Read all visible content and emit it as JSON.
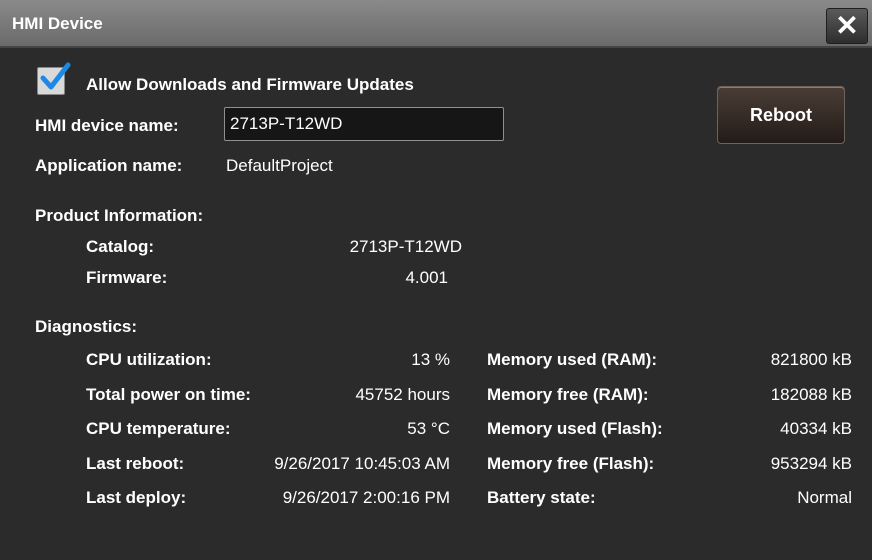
{
  "window": {
    "title": "HMI Device",
    "close_glyph": "✕"
  },
  "settings": {
    "allow_updates_label": "Allow Downloads and Firmware Updates",
    "allow_updates_checked": true,
    "device_name_label": "HMI device name:",
    "device_name_value": "2713P-T12WD",
    "application_name_label": "Application name:",
    "application_name_value": "DefaultProject",
    "reboot_label": "Reboot"
  },
  "product_info": {
    "heading": "Product Information:",
    "catalog_label": "Catalog:",
    "catalog_value": "2713P-T12WD",
    "firmware_label": "Firmware:",
    "firmware_value": "4.001"
  },
  "diagnostics": {
    "heading": "Diagnostics:",
    "left": [
      {
        "label": "CPU utilization:",
        "value": "13 %"
      },
      {
        "label": "Total power on time:",
        "value": "45752 hours"
      },
      {
        "label": "CPU temperature:",
        "value": "53 °C"
      },
      {
        "label": "Last reboot:",
        "value": "9/26/2017 10:45:03 AM"
      },
      {
        "label": "Last deploy:",
        "value": "9/26/2017 2:00:16 PM"
      }
    ],
    "right": [
      {
        "label": "Memory used (RAM):",
        "value": "821800 kB"
      },
      {
        "label": "Memory free (RAM):",
        "value": "182088 kB"
      },
      {
        "label": "Memory used (Flash):",
        "value": "40334 kB"
      },
      {
        "label": "Memory free (Flash):",
        "value": "953294 kB"
      },
      {
        "label": "Battery state:",
        "value": "Normal"
      }
    ]
  },
  "colors": {
    "background": "#2b2b2b",
    "titlebar": "#7a7a7a",
    "checkmark": "#1e88e5"
  }
}
